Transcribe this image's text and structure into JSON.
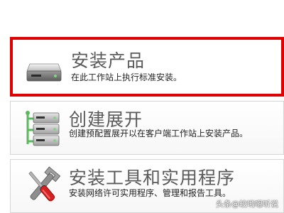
{
  "options": [
    {
      "title": "安装产品",
      "description": "在此工作站上执行标准安装。",
      "icon": "hard-drive-icon",
      "selected": true
    },
    {
      "title": "创建展开",
      "description": "创建预配置展开以在客户端工作站上安装产品。",
      "icon": "server-network-icon",
      "selected": false
    },
    {
      "title": "安装工具和实用程序",
      "description": "安装网络许可实用程序、管理和报告工具。",
      "icon": "tools-icon",
      "selected": false
    }
  ],
  "watermark": "头条@皎哟嗯听说",
  "colors": {
    "selection_border": "#e00000",
    "title_text": "#5a5a5a",
    "panel_border": "#d6d6d6"
  }
}
